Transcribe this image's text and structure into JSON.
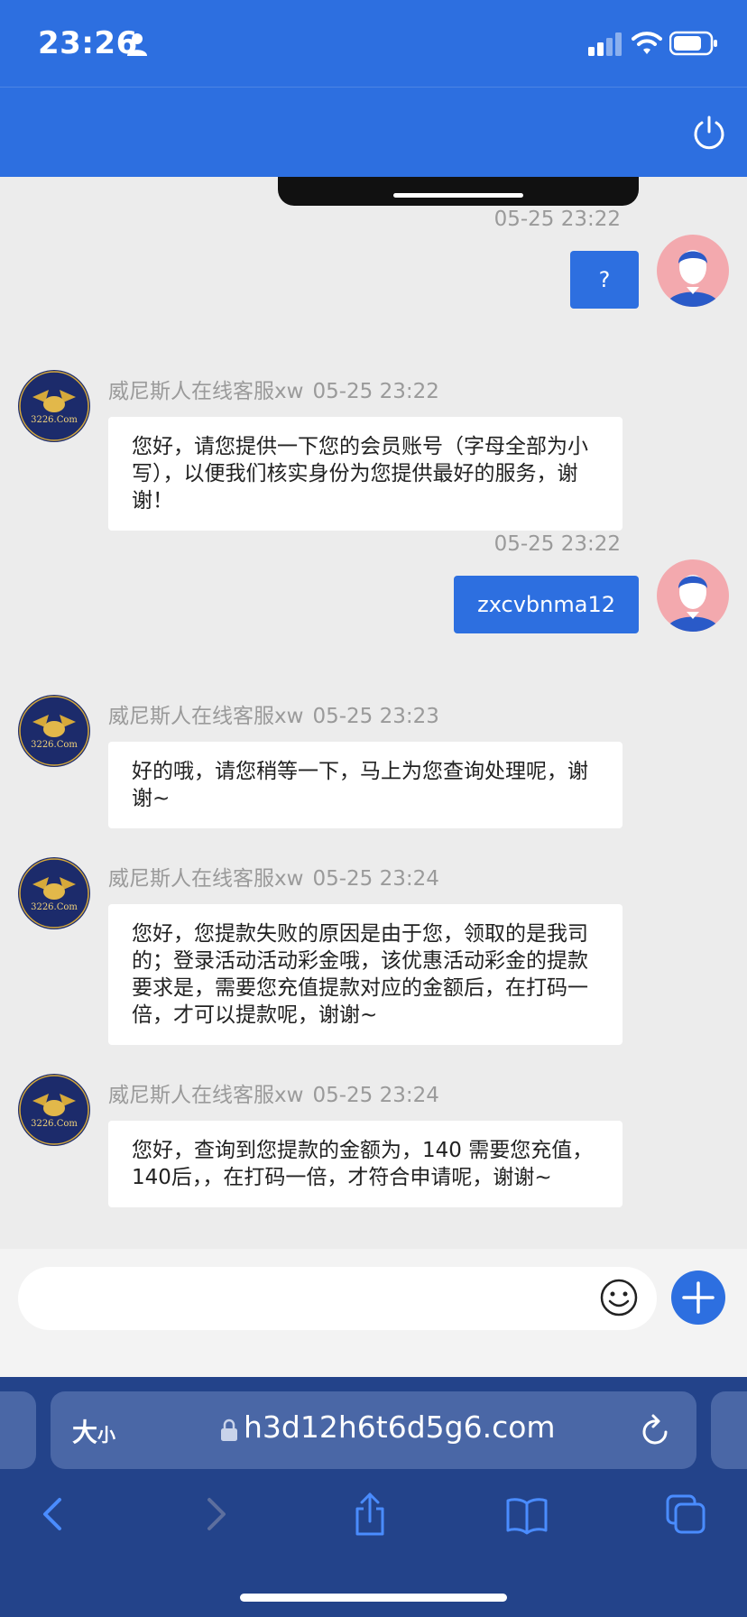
{
  "status_bar": {
    "time": "23:26"
  },
  "chat": {
    "messages": [
      {
        "from": "user",
        "time": "05-25 23:22",
        "text": "?"
      },
      {
        "from": "agent",
        "name": "威尼斯人在线客服xw",
        "time": "05-25 23:22",
        "text": "您好，请您提供一下您的会员账号（字母全部为小写），以便我们核实身份为您提供最好的服务，谢谢！"
      },
      {
        "from": "user",
        "time": "05-25 23:22",
        "text": "zxcvbnma12"
      },
      {
        "from": "agent",
        "name": "威尼斯人在线客服xw",
        "time": "05-25 23:23",
        "text": "好的哦，请您稍等一下，马上为您查询处理呢，谢谢~"
      },
      {
        "from": "agent",
        "name": "威尼斯人在线客服xw",
        "time": "05-25 23:24",
        "text": "您好，您提款失败的原因是由于您，领取的是我司的；登录活动活动彩金哦，该优惠活动彩金的提款要求是，需要您充值提款对应的金额后，在打码一倍，才可以提款呢，谢谢~"
      },
      {
        "from": "agent",
        "name": "威尼斯人在线客服xw",
        "time": "05-25 23:24",
        "text": "您好，查询到您提款的金额为，140 需要您充值，140后，，在打码一倍，才符合申请呢，谢谢~"
      }
    ],
    "agent_logo_text": "3226.Com"
  },
  "input": {
    "placeholder": ""
  },
  "browser": {
    "text_size_big": "大",
    "text_size_small": "小",
    "url": "h3d12h6t6d5g6.com"
  },
  "colors": {
    "accent": "#2d6fe0",
    "browser_bg": "#23438a",
    "address_bar": "#4a67a6"
  }
}
